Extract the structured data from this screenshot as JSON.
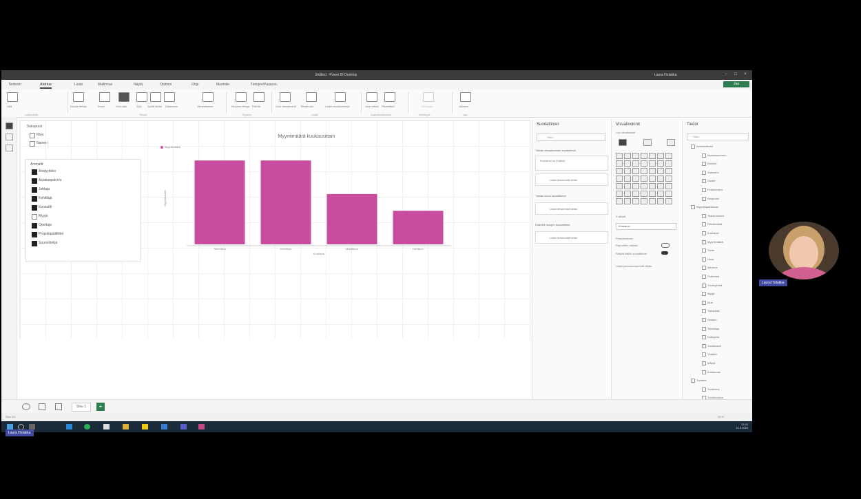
{
  "window": {
    "title": "Untitled - Power BI Desktop",
    "user": "Laura Hotakka"
  },
  "menu": {
    "items": [
      "Tiedosto",
      "Aloitus",
      "Lisää",
      "Mallinnus",
      "Näytä",
      "Optimoi",
      "Ohje",
      "Muotoile",
      "Tietojen/Porausn."
    ],
    "active_index": 1,
    "share_label": "Jaa"
  },
  "ribbon": {
    "buttons": [
      "Liitä",
      "Nouda tietoja",
      "Excel",
      "OneLake",
      "SQL",
      "Syötä tiedot",
      "Dataverse",
      "Viimeaikaiset",
      "Muunna tietoja",
      "Päivitä",
      "Uusi visualisointi",
      "Tekstiruutu",
      "Lisää visualisointeja",
      "Uusi mittari",
      "Pikamittari",
      "Herkkyys",
      "Julkaise"
    ],
    "groups": [
      "Leikepöytä",
      "Tiedot",
      "Kyselyt",
      "Lisää",
      "Laskutoimitukset",
      "Herkkyys",
      "Jaa"
    ]
  },
  "slicer_top": {
    "title": "Sukupuoli",
    "items": [
      {
        "label": "Mies",
        "checked": false
      },
      {
        "label": "Nainen",
        "checked": false
      }
    ]
  },
  "slicer_list": {
    "title": "Ammatti",
    "items": [
      {
        "label": "Analyytikko",
        "checked": true
      },
      {
        "label": "Asiakaspalvelu",
        "checked": true
      },
      {
        "label": "Johtaja",
        "checked": true
      },
      {
        "label": "Kehittäjä",
        "checked": true
      },
      {
        "label": "Konsultti",
        "checked": true
      },
      {
        "label": "Myyjä",
        "checked": false
      },
      {
        "label": "Opettaja",
        "checked": true
      },
      {
        "label": "Projektipäällikkö",
        "checked": true
      },
      {
        "label": "Suunnittelija",
        "checked": true
      }
    ]
  },
  "chart_data": {
    "type": "bar",
    "title": "Myyntimäärä kuukausittain",
    "legend": "Myyntimäärä",
    "categories": [
      "Tammikuu",
      "Helmikuu",
      "Maaliskuu",
      "Huhtikuu"
    ],
    "values": [
      100,
      100,
      60,
      40
    ],
    "ylim": [
      0,
      110
    ],
    "xlabel": "Kuukausi",
    "ylabel": "Myyntimäärä",
    "color": "#c94ca1",
    "grid": false
  },
  "filters": {
    "title": "Suodattimet",
    "search_placeholder": "Haku",
    "sections": [
      {
        "title": "Tämän visualisoinnin suodattimet",
        "box": "Lisää tietokentät tähän"
      },
      {
        "title": "Tämän sivun suodattimet",
        "box": "Lisää tietokentät tähän"
      },
      {
        "title": "Kaikkien sivujen suodattimet",
        "box": "Lisää tietokentät tähän"
      }
    ],
    "applied_field": "Kuukausi on (Kaikki)"
  },
  "visualizations": {
    "title": "Visualisoinnit",
    "subtitle": "Luo visualisointi",
    "fields_label": "X-akseli",
    "field_value": "Kuukausi",
    "drill_label": "Porautuminen",
    "cross_report": "Raporttien välinen",
    "keep_filters": "Säilytä kaikki suodattimet",
    "add_fields": "Lisää porautumiskentät tähän"
  },
  "data_pane": {
    "title": "Tiedot",
    "search_placeholder": "Haku",
    "items": [
      "Asiakastiedot",
      "Asiakasnumero",
      "Etunimi",
      "Sukunimi",
      "Osoite",
      "Postinumero",
      "Kaupunki",
      "Myyntitapahtumat",
      "Tilausnumero",
      "Päivämäärä",
      "Kuukausi",
      "Myyntimäärä",
      "Tuote",
      "Hinta",
      "Alennus",
      "Yhteensä",
      "Tuoteryhmä",
      "Myyjä",
      "Alue",
      "Toimipiste",
      "Varasto",
      "Toimittaja",
      "Kategoria",
      "Tuotekoodi",
      "Yksikkö",
      "Määrä",
      "Kustannus",
      "Tuotteet",
      "Tuotenimi",
      "Tuotekuvaus"
    ]
  },
  "pages": {
    "tabs": [
      "Sivu 1"
    ],
    "add_label": "+"
  },
  "status": {
    "page": "Sivu 1/1",
    "zoom": "53 %"
  },
  "taskbar": {
    "time": "13.42",
    "date": "14.3.2024"
  },
  "webcam": {
    "name": "Laura Hotakka"
  },
  "presenter": {
    "name": "Laura Hotakka"
  }
}
